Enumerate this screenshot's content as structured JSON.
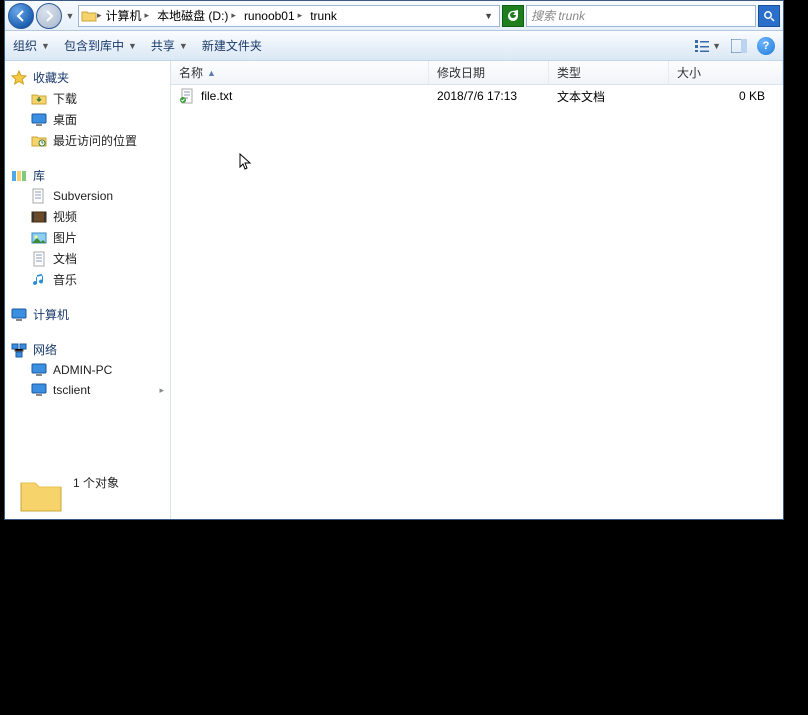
{
  "breadcrumbs": [
    "计算机",
    "本地磁盘 (D:)",
    "runoob01",
    "trunk"
  ],
  "search": {
    "placeholder": "搜索 trunk"
  },
  "toolbar": {
    "organize": "组织",
    "include": "包含到库中",
    "share": "共享",
    "newfolder": "新建文件夹"
  },
  "columns": {
    "name": "名称",
    "date": "修改日期",
    "type": "类型",
    "size": "大小"
  },
  "files": [
    {
      "name": "file.txt",
      "date": "2018/7/6 17:13",
      "type": "文本文档",
      "size": "0 KB"
    }
  ],
  "sidebar": {
    "favorites": {
      "label": "收藏夹",
      "items": [
        "下载",
        "桌面",
        "最近访问的位置"
      ]
    },
    "libraries": {
      "label": "库",
      "items": [
        "Subversion",
        "视频",
        "图片",
        "文档",
        "音乐"
      ]
    },
    "computer": {
      "label": "计算机"
    },
    "network": {
      "label": "网络",
      "items": [
        "ADMIN-PC",
        "tsclient"
      ]
    }
  },
  "status": "1 个对象"
}
